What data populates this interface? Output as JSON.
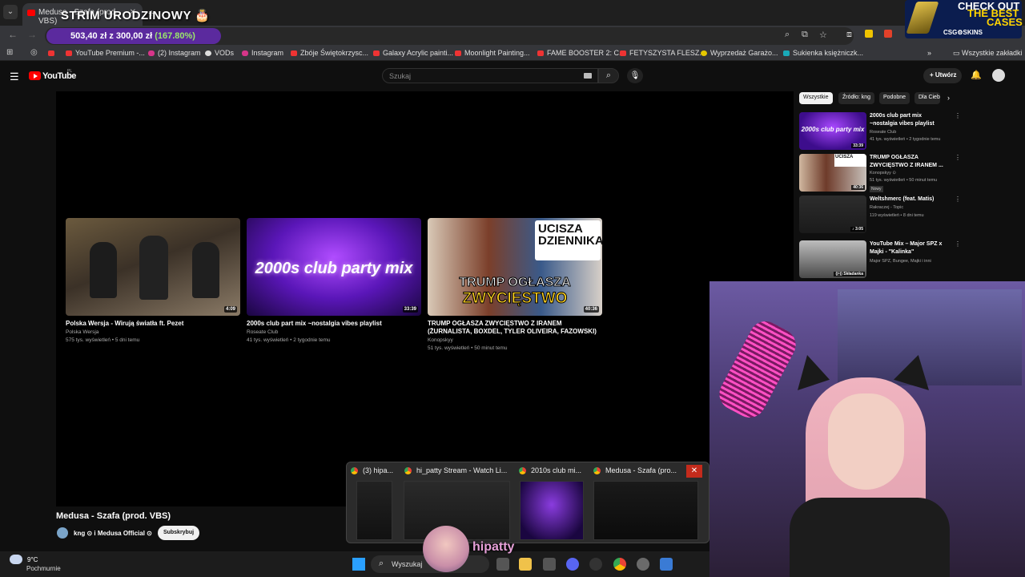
{
  "browser": {
    "tab_title": "Medusa - Szafa (prod. VBS)",
    "overlay_title": "STRIM URODZINOWY 🎂",
    "donation": {
      "amount": "503,40 zł z 300,00 zł",
      "percent": "(167.80%)"
    },
    "bookmarks": [
      "YouTube Premium -...",
      "(2) Instagram",
      "VODs",
      "Instagram",
      "Zbóje Świętokrzysc...",
      "Galaxy Acrylic painti...",
      "Moonlight Painting...",
      "FAME BOOSTER 2: C...",
      "FETYSZYSTA FLESZ...",
      "Wyprzedaż Garażo...",
      "Sukienka księżniczk..."
    ],
    "all_bookmarks": "Wszystkie zakładki"
  },
  "ad": {
    "line1": "CHECK OUT",
    "line2": "THE BEST",
    "line3": "CASES",
    "logo": "CSG⚙SKINS"
  },
  "youtube": {
    "logo": "YouTube",
    "region": "PL",
    "search_placeholder": "Szukaj",
    "create_label": "+ Utwórz",
    "endscreen": [
      {
        "title": "Polska Wersja - Wirują światła ft. Pezet",
        "channel": "Polska Wersja",
        "meta": "575 tys. wyświetleń • 5 dni temu",
        "duration": "4:09"
      },
      {
        "title": "2000s club part mix ~nostalgia vibes playlist",
        "channel": "Roseate Club",
        "meta": "41 tys. wyświetleń • 2 tygodnie temu",
        "duration": "33:39",
        "thumb_text": "2000s club party mix"
      },
      {
        "title": "TRUMP OGŁASZA ZWYCIĘSTWO Z IRANEM (ŻURNALISTA, BOXDEL, TYLER OLIVEIRA, FAZOWSKI)",
        "channel": "Konopskyy",
        "meta": "51 tys. wyświetleń • 50 minut temu",
        "duration": "40:36",
        "thumb_top": "UCISZA DZIENNIKARZA",
        "thumb_bottom1": "TRUMP OGŁASZA",
        "thumb_bottom2": "ZWYCIĘSTWO"
      }
    ],
    "video_title": "Medusa - Szafa (prod. VBS)",
    "channel_line": "kng ⊙ i Medusa Official ⊙",
    "subscribe": "Subskrybuj",
    "chips": [
      "Wszystkie",
      "Źródło: kng",
      "Podobne",
      "Dla Ciebie"
    ],
    "sidebar": [
      {
        "title": "2000s club part mix ~nostalgia vibes playlist",
        "channel": "Roseate Club",
        "meta": "41 tys. wyświetleń • 2 tygodnie temu",
        "duration": "33:39",
        "thumb_text": "2000s club party mix"
      },
      {
        "title": "TRUMP OGŁASZA ZWYCIĘSTWO Z IRANEM ...",
        "channel": "Konopskyy ⊙",
        "meta": "51 tys. wyświetleń • 50 minut temu",
        "duration": "40:36",
        "badge": "Nowy"
      },
      {
        "title": "Weltshmerc (feat. Matis)",
        "channel": "Rakraczej - Topic",
        "meta": "119 wyświetleń • 8 dni temu",
        "duration": "♪ 3:05"
      },
      {
        "title": "YouTube Mix – Major SPZ x Majki - \"Kalinka\"",
        "channel": "Major SPZ, Bungee, Majki i inni",
        "meta": "",
        "duration": "((•)) Składanka"
      }
    ]
  },
  "taskbar_preview": [
    {
      "label": "(3) hipa..."
    },
    {
      "label": "hi_patty Stream - Watch Li..."
    },
    {
      "label": "2010s club mi..."
    },
    {
      "label": "Medusa - Szafa (pro..."
    }
  ],
  "taskbar": {
    "temp": "9°C",
    "condition": "Pochmurnie",
    "search": "Wyszukaj"
  },
  "streamer_name": "hipatty"
}
